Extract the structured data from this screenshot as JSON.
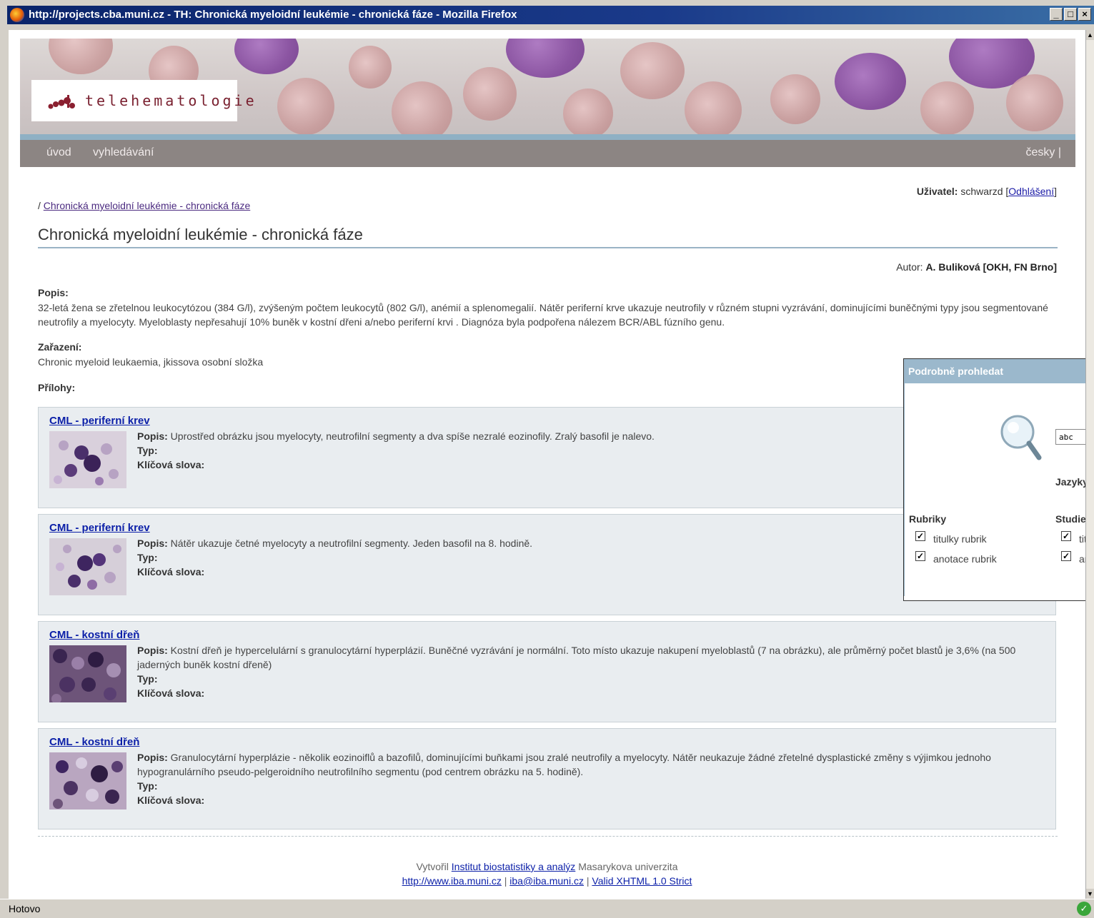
{
  "window": {
    "title": "http://projects.cba.muni.cz - TH: Chronická myeloidní leukémie - chronická fáze - Mozilla Firefox",
    "status": "Hotovo"
  },
  "site": {
    "logo_text": "telehematologie",
    "nav": {
      "home": "úvod",
      "search": "vyhledávání",
      "language": "česky |"
    }
  },
  "user": {
    "label": "Uživatel:",
    "name": "schwarzd",
    "logout": "Odhlášení"
  },
  "breadcrumb": {
    "prefix": "/",
    "link": "Chronická myeloidní leukémie - chronická fáze"
  },
  "page": {
    "title": "Chronická myeloidní leukémie - chronická fáze",
    "author_label": "Autor:",
    "author": "A. Buliková [OKH, FN Brno]",
    "popis_label": "Popis:",
    "popis": "32-letá žena se zřetelnou leukocytózou (384 G/l), zvýšeným počtem leukocytů (802 G/l), anémií a splenomegalií. Nátěr periferní krve ukazuje neutrofily v různém stupni vyzrávání, dominujícími buněčnými typy jsou segmentované neutrofily a myelocyty. Myeloblasty nepřesahují 10% buněk v kostní dřeni a/nebo periferní krvi . Diagnóza byla podpořena nálezem BCR/ABL fúzního genu.",
    "zarazeni_label": "Zařazení:",
    "zarazeni": "Chronic myeloid leukaemia, jkissova osobní složka",
    "prilohy_label": "Přílohy:"
  },
  "attachments": [
    {
      "title": "CML - periferní krev",
      "popis_label": "Popis:",
      "popis": "Uprostřed obrázku jsou myelocyty, neutrofilní segmenty a dva spíše nezralé eozinofily. Zralý basofil je nalevo.",
      "typ_label": "Typ:",
      "klic_label": "Klíčová slova:"
    },
    {
      "title": "CML - periferní krev",
      "popis_label": "Popis:",
      "popis": "Nátěr ukazuje četné myelocyty a neutrofilní segmenty. Jeden basofil na 8. hodině.",
      "typ_label": "Typ:",
      "klic_label": "Klíčová slova:"
    },
    {
      "title": "CML - kostní dřeň",
      "popis_label": "Popis:",
      "popis": "Kostní dřeň je hypercelulární s granulocytární hyperplázií. Buněčné vyzrávání je normální. Toto místo ukazuje nakupení myeloblastů (7 na obrázku), ale průměrný počet blastů je 3,6% (na 500 jaderných buněk kostní dřeně)",
      "typ_label": "Typ:",
      "klic_label": "Klíčová slova:"
    },
    {
      "title": "CML - kostní dřeň",
      "popis_label": "Popis:",
      "popis": "Granulocytární hyperplázie - několik eozinoiflů a bazofilů, dominujícími buňkami jsou zralé neutrofily a myelocyty. Nátěr neukazuje žádné zřetelné dysplastické změny s výjimkou jednoho hypogranulárního pseudo-pelgeroidního neutrofilního segmentu (pod centrem obrázku na 5. hodině).",
      "typ_label": "Typ:",
      "klic_label": "Klíčová slova:"
    }
  ],
  "footer": {
    "created_by": "Vytvořil",
    "institute": "Institut biostatistiky a analýz",
    "university": "Masarykova univerzita",
    "url": "http://www.iba.muni.cz",
    "email": "iba@iba.muni.cz",
    "validator": "Valid XHTML 1.0 Strict",
    "separator": "|"
  },
  "search_popup": {
    "title": "Podrobně prohledat",
    "query": "abc",
    "languages_label": "Jazyky",
    "rubriky_label": "Rubriky",
    "studie_label": "Studie",
    "rubriky_options": [
      "titulky rubrik",
      "anotace rubrik"
    ],
    "studie_options": [
      "titu",
      "anc"
    ]
  },
  "colors": {
    "link": "#0b1fa8",
    "nav_bg": "#8c8583",
    "accent_line": "#9ab3c5",
    "popup_header": "#9bb8cc",
    "attachment_bg": "#e9edf0"
  },
  "icons": [
    "firefox-icon",
    "minimize-icon",
    "maximize-icon",
    "close-icon",
    "search-magnifier-icon",
    "checkbox-checked-icon",
    "status-ok-icon"
  ]
}
